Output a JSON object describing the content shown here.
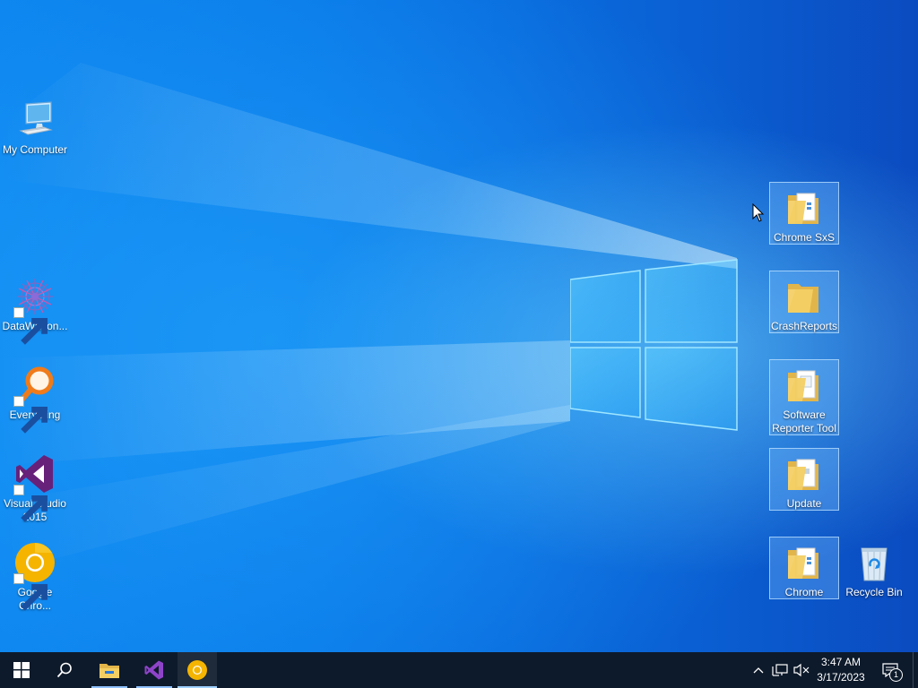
{
  "desktop": {
    "icons_left": [
      {
        "label": "My Computer",
        "icon": "computer-icon",
        "shortcut": false
      },
      {
        "label": "DataWagon...",
        "icon": "datawagon-icon",
        "shortcut": true
      },
      {
        "label": "Everything",
        "icon": "everything-search-icon",
        "shortcut": true
      },
      {
        "label": "Visual Studio 2015",
        "icon": "visual-studio-icon",
        "shortcut": true
      },
      {
        "label": "Google Chro...",
        "icon": "chrome-canary-icon",
        "shortcut": true
      }
    ],
    "icons_right": [
      {
        "label": "Chrome SxS",
        "icon": "folder-icon"
      },
      {
        "label": "CrashReports",
        "icon": "folder-icon"
      },
      {
        "label": "Software Reporter Tool",
        "icon": "folder-icon"
      },
      {
        "label": "Update",
        "icon": "folder-icon"
      },
      {
        "label": "Chrome",
        "icon": "folder-icon"
      },
      {
        "label": "Recycle Bin",
        "icon": "recycle-bin-icon"
      }
    ]
  },
  "taskbar": {
    "apps": [
      {
        "name": "start",
        "icon": "windows-start-icon"
      },
      {
        "name": "search",
        "icon": "search-icon"
      },
      {
        "name": "file-explorer",
        "icon": "file-explorer-icon"
      },
      {
        "name": "visual-studio",
        "icon": "visual-studio-icon"
      },
      {
        "name": "chrome-canary",
        "icon": "chrome-canary-icon"
      }
    ],
    "tray": {
      "time": "3:47 AM",
      "date": "3/17/2023",
      "notification_count": "1",
      "icons": [
        "chevron-up-icon",
        "network-icon",
        "volume-muted-icon",
        "action-center-icon"
      ]
    }
  },
  "colors": {
    "taskbar": "#0d1a2b",
    "desktop_accent": "#0a6fe0",
    "folder": "#f3cf63",
    "vs_purple": "#68217a",
    "canary_yellow": "#f4b400"
  }
}
